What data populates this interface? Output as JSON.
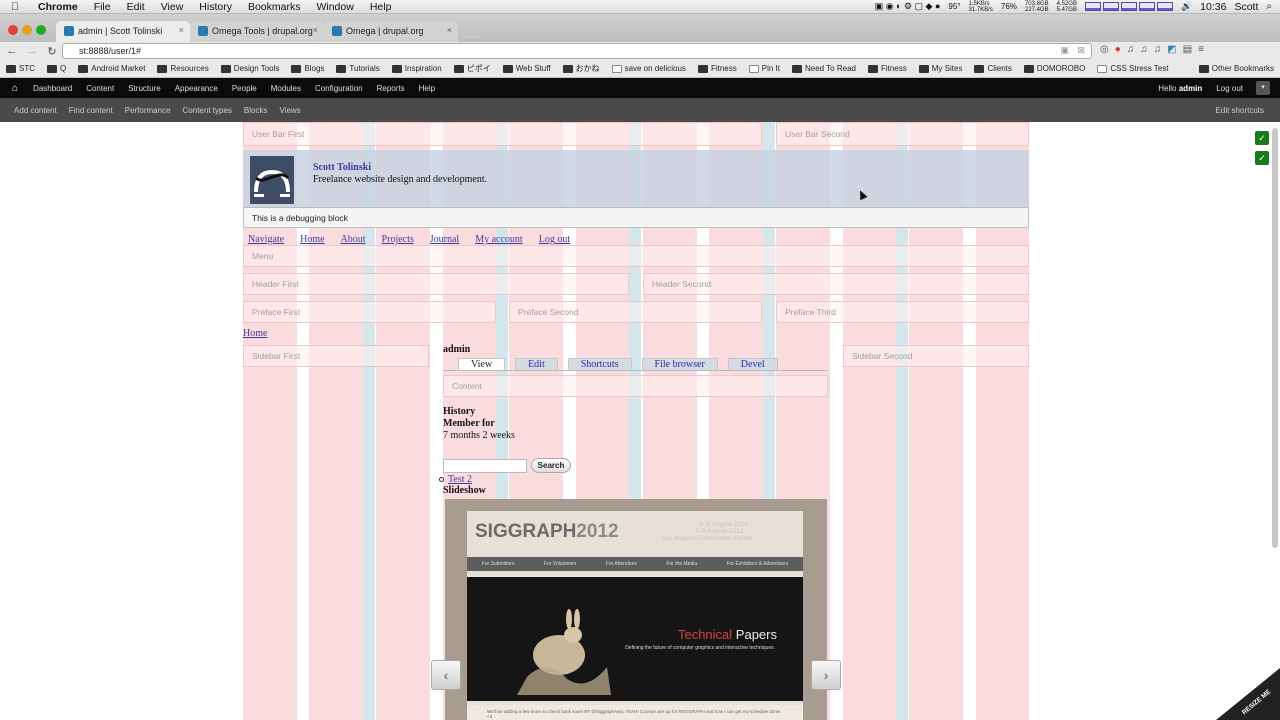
{
  "mac_menubar": {
    "app": "Chrome",
    "menus": [
      "File",
      "Edit",
      "View",
      "History",
      "Bookmarks",
      "Window",
      "Help"
    ],
    "temperature": "95°",
    "net_up": "1.5KB/s",
    "net_down": "31.7KB/s",
    "battery": "76%",
    "disk_used": "703.8GB",
    "disk_free": "227.4GB",
    "mem_used": "4.52GB",
    "mem_free": "5.47GB",
    "clock": "10:36",
    "user": "Scott"
  },
  "tabs": [
    {
      "title": "admin | Scott Tolinski",
      "active": true
    },
    {
      "title": "Omega Tools | drupal.org",
      "active": false
    },
    {
      "title": "Omega | drupal.org",
      "active": false
    }
  ],
  "address": "st:8888/user/1#",
  "bookmarks": [
    "STC",
    "Q",
    "Android Market",
    "Resources",
    "Design Tools",
    "Blogs",
    "Tutorials",
    "Inspiration",
    "ピポイ",
    "Web Stuff",
    "おかね",
    "save on delicious",
    "Fitness",
    "Pin It",
    "Need To Read",
    "Fitness",
    "My Sites",
    "Clients",
    "DOMOROBO",
    "CSS Stress Test",
    "Other Bookmarks"
  ],
  "drupal_toolbar": {
    "items": [
      "Dashboard",
      "Content",
      "Structure",
      "Appearance",
      "People",
      "Modules",
      "Configuration",
      "Reports",
      "Help"
    ],
    "hello": "Hello",
    "user": "admin",
    "logout": "Log out"
  },
  "shortcuts": {
    "items": [
      "Add content",
      "Find content",
      "Performance",
      "Content types",
      "Blocks",
      "Views"
    ],
    "edit": "Edit shortcuts"
  },
  "regions": {
    "user_first": "User Bar First",
    "user_second": "User Bar Second",
    "menu": "Menu",
    "header_first": "Header First",
    "header_second": "Header Second",
    "preface_first": "Preface First",
    "preface_second": "Preface Second",
    "preface_third": "Preface Third",
    "sidebar_first": "Sidebar First",
    "sidebar_second": "Sidebar Second",
    "content": "Content"
  },
  "site": {
    "name": "Scott Tolinski",
    "slogan": "Freelance website design and development."
  },
  "debug_block": "This is a debugging block",
  "main_nav": [
    "Navigate",
    "Home",
    "About",
    "Projects",
    "Journal",
    "My account",
    "Log out"
  ],
  "breadcrumb": "Home",
  "page_title": "admin",
  "page_tabs": [
    {
      "label": "View",
      "active": true
    },
    {
      "label": "Edit",
      "active": false
    },
    {
      "label": "Shortcuts",
      "active": false
    },
    {
      "label": "File browser",
      "active": false
    },
    {
      "label": "Devel",
      "active": false
    }
  ],
  "history": {
    "heading": "History",
    "member_for": "Member for",
    "duration": "7 months 2 weeks"
  },
  "search": {
    "button": "Search",
    "value": ""
  },
  "list_link": "Test 2",
  "slideshow": {
    "label": "Slideshow",
    "prev": "‹",
    "next": "›",
    "slide": {
      "logo": "SIGGRAPH",
      "year": "2012",
      "conference": "Conference",
      "conference_dates": "5–9 August 2012",
      "exhibition": "Exhibition",
      "exhibition_dates": "7–9 August 2012",
      "city": "Los Angeles Convention Center",
      "nav": [
        "For Submitters",
        "For Volunteers",
        "For Attendees",
        "For the Media",
        "For Exhibitors & Advertisers"
      ],
      "hero_title_a": "Technical",
      "hero_title_b": "Papers",
      "hero_sub": "Defining the future of computer graphics and interactive techniques.",
      "footer": "We'll be adding a few more so check back soon! RT @SiggraphAsia: YEAH! Courses are up for #SIGGRAPH and now I can get my schedule done! <3"
    }
  },
  "resize_label": "RESIZE ME",
  "colors": {
    "grid_col": "#fbdcde",
    "grid_blue": "#d3e6ec",
    "link": "#3a3aa0",
    "toolbar": "#0b0b0b"
  }
}
